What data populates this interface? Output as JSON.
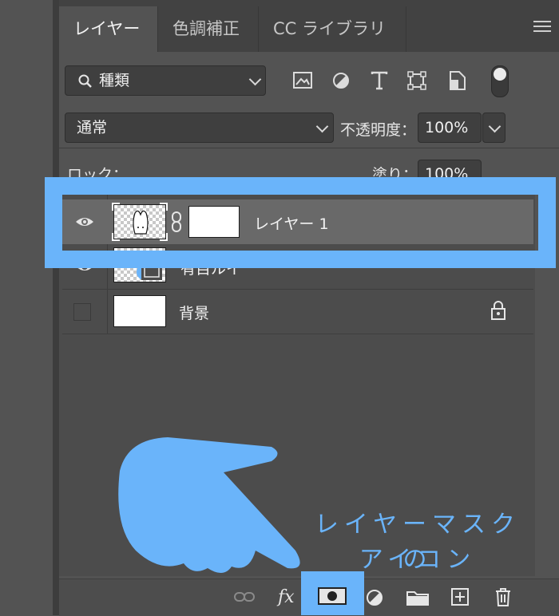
{
  "tabs": [
    {
      "label": "レイヤー",
      "active": true
    },
    {
      "label": "色調補正",
      "active": false
    },
    {
      "label": "CC ライブラリ",
      "active": false
    }
  ],
  "filter": {
    "label": "種類"
  },
  "blend": {
    "mode": "通常",
    "opacity_label": "不透明度：",
    "opacity_value": "100%"
  },
  "lock": {
    "label": "ロック：",
    "fill_label": "塗り：",
    "fill_value": "100%"
  },
  "layers": [
    {
      "name": "レイヤー 1"
    },
    {
      "name": "有目ルイ"
    },
    {
      "name": "背景"
    }
  ],
  "annotation": {
    "line1": "レイヤーマスクの",
    "line2": "アイコン"
  },
  "icons": {
    "search": "search-icon",
    "image": "image-filter-icon",
    "adjust": "adjustment-filter-icon",
    "type": "type-filter-icon",
    "shape": "shape-filter-icon",
    "smart": "smart-object-filter-icon",
    "toggle": "filter-toggle-icon",
    "eye": "eye-icon",
    "lock": "lock-icon",
    "link": "link-icon",
    "fx": "fx-icon",
    "mask": "layer-mask-icon",
    "adjustment_layer": "adjustment-layer-icon",
    "folder": "folder-icon",
    "new_layer": "new-layer-icon",
    "trash": "trash-icon"
  },
  "colors": {
    "accent": "#6ab4fa",
    "panel": "#535353",
    "selected_row": "#696969"
  }
}
